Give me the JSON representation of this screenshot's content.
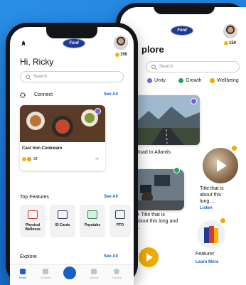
{
  "back": {
    "title": "plore",
    "coins": "150",
    "search_placeholder": "Search",
    "chips": [
      "Unity",
      "Growth",
      "Wellbeing"
    ],
    "card1_title": "Road to Atlantis",
    "card2_title_l1": "Title that is",
    "card2_title_l2": "about this",
    "card2_title_l3": "long ...",
    "card3_title_l1": "le Title that is",
    "card3_title_l2": "about this long and",
    "card3_title_l3": "...",
    "listen": "Listen",
    "feature_title": "Feature!",
    "learn_more": "Learn More"
  },
  "front": {
    "greeting": "Hi, Ricky",
    "coins": "150",
    "search_placeholder": "Search",
    "connect": "Connect",
    "see_all": "See All",
    "card_title": "Cast Iron Cookware",
    "card_likes": "28",
    "top_features": "Top Features",
    "features": [
      "Physical Wellness",
      "ID Cards",
      "Paystubs",
      "PTO"
    ],
    "explore": "Explore",
    "tabs": [
      "Home",
      "Connect",
      "",
      "Wellne",
      "Explore"
    ]
  },
  "colors": {
    "background": "#1a73d6",
    "accent": "#1a5fc4",
    "ford": "#1f3a93"
  }
}
